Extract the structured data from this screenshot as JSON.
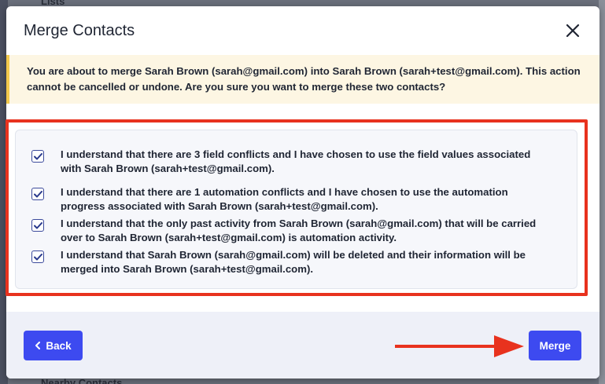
{
  "background": {
    "top_text": "Lists",
    "bottom_text": "Nearby Contacts"
  },
  "modal": {
    "title": "Merge Contacts",
    "close_icon": "close-icon",
    "warning": {
      "prefix": "You are about to merge ",
      "source_contact": "Sarah Brown (sarah@gmail.com)",
      "middle": " into ",
      "target_contact": "Sarah Brown (sarah+test@gmail.com)",
      "suffix": ". This action cannot be cancelled or undone. Are you sure you want to merge these two contacts?"
    },
    "confirmations": [
      {
        "checked": true,
        "line1": "I understand that there are 3 field conflicts and I have chosen to use the field values associated",
        "line2": "with Sarah Brown (sarah+test@gmail.com)."
      },
      {
        "checked": true,
        "line1": "I understand that there are 1 automation conflicts and I have chosen to use the automation",
        "line2": "progress associated with Sarah Brown (sarah+test@gmail.com)."
      },
      {
        "checked": true,
        "line1": "I understand that the only past activity from Sarah Brown (sarah@gmail.com) that will be carried",
        "line2": "over to Sarah Brown (sarah+test@gmail.com) is automation activity."
      },
      {
        "checked": true,
        "line1": "I understand that Sarah Brown (sarah@gmail.com) will be deleted and their information will be",
        "line2": "merged into Sarah Brown (sarah+test@gmail.com)."
      }
    ],
    "footer": {
      "back_label": "Back",
      "merge_label": "Merge"
    }
  },
  "colors": {
    "primary_button": "#3d4af0",
    "warning_bg": "#fdf6e3",
    "warning_accent": "#f2c94c",
    "annotation_red": "#e8321e",
    "checkbox_border": "#3b4a9c"
  }
}
